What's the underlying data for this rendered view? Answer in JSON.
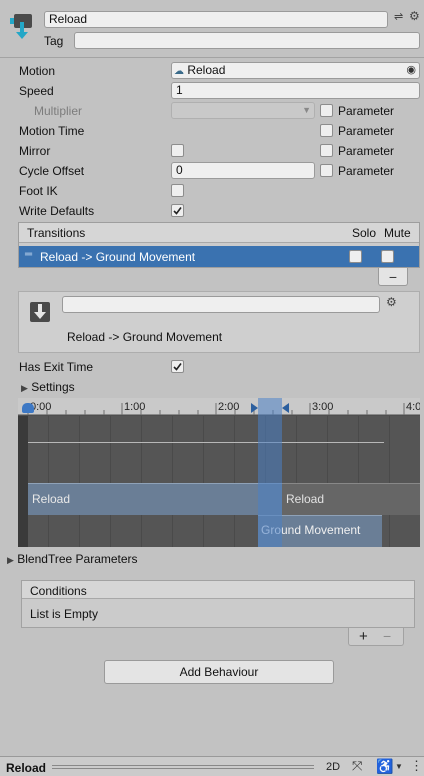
{
  "header": {
    "name_value": "Reload",
    "tag_label": "Tag",
    "tag_value": ""
  },
  "props": {
    "motion_label": "Motion",
    "motion_value": "Reload",
    "speed_label": "Speed",
    "speed_value": "1",
    "multiplier_label": "Multiplier",
    "motion_time_label": "Motion Time",
    "mirror_label": "Mirror",
    "cycle_offset_label": "Cycle Offset",
    "cycle_offset_value": "0",
    "foot_ik_label": "Foot IK",
    "write_defaults_label": "Write Defaults",
    "parameter_label": "Parameter"
  },
  "transitions": {
    "title": "Transitions",
    "solo": "Solo",
    "mute": "Mute",
    "items": [
      {
        "label": "Reload -> Ground Movement",
        "selected": true
      }
    ],
    "remove_label": "−"
  },
  "transition_detail": {
    "name_value": "",
    "title": "Reload -> Ground Movement",
    "has_exit_time_label": "Has Exit Time",
    "settings_label": "Settings"
  },
  "timeline": {
    "ticks": [
      "0:00",
      "1:00",
      "2:00",
      "3:00",
      "4:0"
    ],
    "source_state": "Reload",
    "source_state_repeat": "Reload",
    "dest_state": "Ground Movement"
  },
  "blendtree": {
    "label": "BlendTree Parameters"
  },
  "conditions": {
    "title": "Conditions",
    "empty_text": "List is Empty",
    "add_label": "+",
    "remove_label": "−"
  },
  "add_behaviour_label": "Add Behaviour",
  "bottom": {
    "title": "Reload",
    "mode_2d": "2D"
  },
  "colors": {
    "selection": "#3a72b0",
    "accent": "#4b7fc4"
  }
}
